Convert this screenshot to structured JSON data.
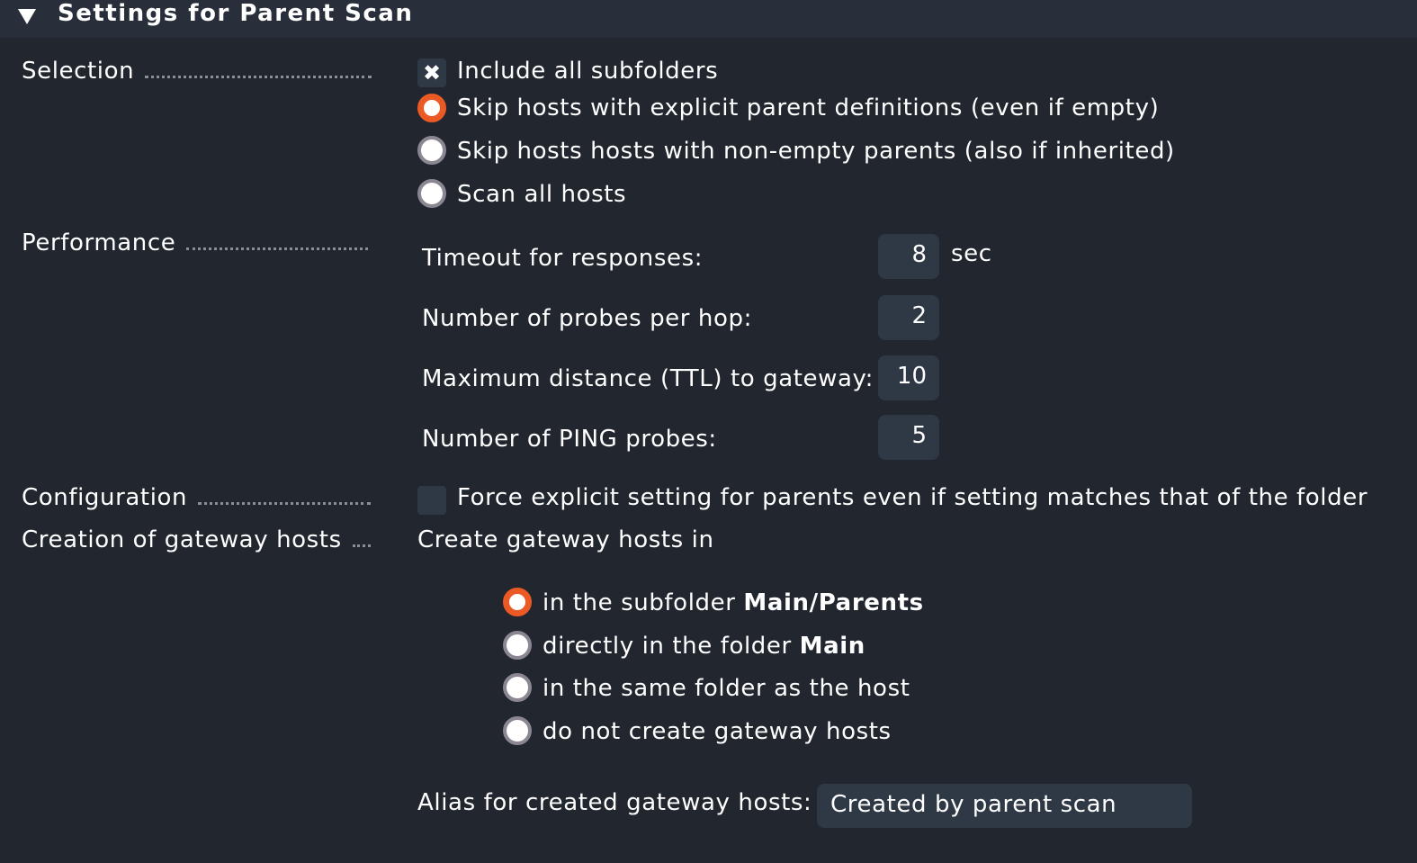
{
  "section": {
    "title": "Settings for Parent Scan",
    "collapse_icon": "triangle-down-icon"
  },
  "selection": {
    "label": "Selection",
    "include_subfolders": {
      "label": "Include all subfolders",
      "checked": true
    },
    "radio_options": [
      {
        "label": "Skip hosts with explicit parent definitions (even if empty)",
        "selected": true
      },
      {
        "label": "Skip hosts hosts with non-empty parents (also if inherited)",
        "selected": false
      },
      {
        "label": "Scan all hosts",
        "selected": false
      }
    ]
  },
  "performance": {
    "label": "Performance",
    "fields": [
      {
        "label": "Timeout for responses:",
        "value": "8",
        "unit": "sec"
      },
      {
        "label": "Number of probes per hop:",
        "value": "2",
        "unit": ""
      },
      {
        "label": "Maximum distance (TTL) to gateway:",
        "value": "10",
        "unit": ""
      },
      {
        "label": "Number of PING probes:",
        "value": "5",
        "unit": ""
      }
    ]
  },
  "configuration": {
    "label": "Configuration",
    "force_explicit": {
      "label": "Force explicit setting for parents even if setting matches that of the folder",
      "checked": false
    }
  },
  "gateway": {
    "label": "Creation of gateway hosts",
    "intro": "Create gateway hosts in",
    "options": [
      {
        "prefix": "in the subfolder ",
        "bold": "Main/Parents",
        "selected": true
      },
      {
        "prefix": "directly in the folder ",
        "bold": "Main",
        "selected": false
      },
      {
        "prefix": "in the same folder as the host",
        "bold": "",
        "selected": false
      },
      {
        "prefix": "do not create gateway hosts",
        "bold": "",
        "selected": false
      }
    ],
    "alias_label": "Alias for created gateway hosts:",
    "alias_value": "Created by parent scan"
  },
  "colors": {
    "background": "#21262f",
    "header_bg": "#282f3a",
    "input_bg": "#2f3845",
    "accent": "#eb5a25"
  }
}
